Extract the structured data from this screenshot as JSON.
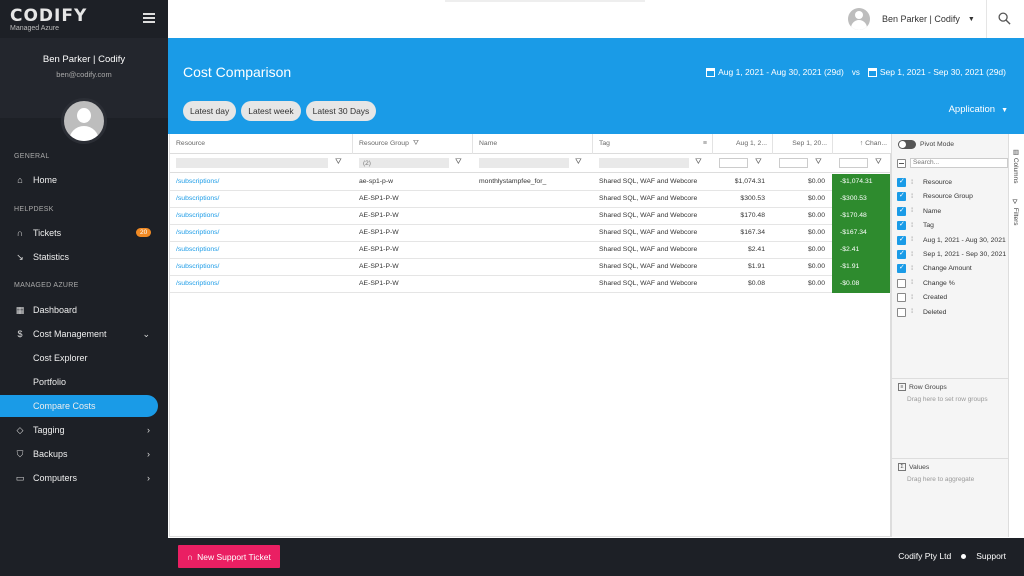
{
  "brand": {
    "logo": "CODIFY",
    "subtitle": "Managed Azure"
  },
  "user": {
    "name": "Ben Parker | Codify",
    "email": "ben@codify.com",
    "top_name": "Ben Parker | Codify"
  },
  "nav": {
    "general_label": "GENERAL",
    "helpdesk_label": "HELPDESK",
    "managed_label": "MANAGED AZURE",
    "home": "Home",
    "tickets": "Tickets",
    "tickets_badge": "20",
    "statistics": "Statistics",
    "dashboard": "Dashboard",
    "cost_management": "Cost Management",
    "cost_explorer": "Cost Explorer",
    "portfolio": "Portfolio",
    "compare_costs": "Compare Costs",
    "tagging": "Tagging",
    "backups": "Backups",
    "computers": "Computers"
  },
  "hero": {
    "title": "Cost Comparison",
    "range_a": "Aug 1, 2021 - Aug 30, 2021 (29d)",
    "vs": "vs",
    "range_b": "Sep 1, 2021 - Sep 30, 2021 (29d)",
    "pills": [
      "Latest day",
      "Latest week",
      "Latest 30 Days"
    ],
    "group_select": "Application"
  },
  "grid": {
    "headers": [
      "Resource",
      "Resource Group",
      "Name",
      "Tag",
      "Aug 1, 2...",
      "Sep 1, 20...",
      "Chan..."
    ],
    "filter_rg_value": "(2)",
    "rows": [
      [
        "/subscriptions/",
        "ae-sp1-p-w",
        "monthlystampfee_for_",
        "Shared SQL, WAF and Webcore",
        "$1,074.31",
        "$0.00",
        "-$1,074.31"
      ],
      [
        "/subscriptions/",
        "AE-SP1-P-W",
        "",
        "Shared SQL, WAF and Webcore",
        "$300.53",
        "$0.00",
        "-$300.53"
      ],
      [
        "/subscriptions/",
        "AE-SP1-P-W",
        "",
        "Shared SQL, WAF and Webcore",
        "$170.48",
        "$0.00",
        "-$170.48"
      ],
      [
        "/subscriptions/",
        "AE-SP1-P-W",
        "",
        "Shared SQL, WAF and Webcore",
        "$167.34",
        "$0.00",
        "-$167.34"
      ],
      [
        "/subscriptions/",
        "AE-SP1-P-W",
        "",
        "Shared SQL, WAF and Webcore",
        "$2.41",
        "$0.00",
        "-$2.41"
      ],
      [
        "/subscriptions/",
        "AE-SP1-P-W",
        "",
        "Shared SQL, WAF and Webcore",
        "$1.91",
        "$0.00",
        "-$1.91"
      ],
      [
        "/subscriptions/",
        "AE-SP1-P-W",
        "",
        "Shared SQL, WAF and Webcore",
        "$0.08",
        "$0.00",
        "-$0.08"
      ]
    ]
  },
  "panel": {
    "pivot_mode": "Pivot Mode",
    "search_placeholder": "Search...",
    "columns": [
      {
        "label": "Resource",
        "checked": true
      },
      {
        "label": "Resource Group",
        "checked": true
      },
      {
        "label": "Name",
        "checked": true
      },
      {
        "label": "Tag",
        "checked": true
      },
      {
        "label": "Aug 1, 2021 - Aug 30, 2021",
        "checked": true
      },
      {
        "label": "Sep 1, 2021 - Sep 30, 2021",
        "checked": true
      },
      {
        "label": "Change Amount",
        "checked": true
      },
      {
        "label": "Change %",
        "checked": false
      },
      {
        "label": "Created",
        "checked": false
      },
      {
        "label": "Deleted",
        "checked": false
      }
    ],
    "row_groups_title": "Row Groups",
    "row_groups_hint": "Drag here to set row groups",
    "values_title": "Values",
    "values_hint": "Drag here to aggregate",
    "tab_columns": "Columns",
    "tab_filters": "Filters"
  },
  "footer": {
    "support_button": "New Support Ticket",
    "company": "Codify Pty Ltd",
    "support_link": "Support"
  },
  "colors": {
    "accent": "#1a9be7",
    "sidebar": "#1d2026",
    "change_negative": "#2e8b2e",
    "support_button": "#ea1f63",
    "badge": "#f08a24"
  }
}
